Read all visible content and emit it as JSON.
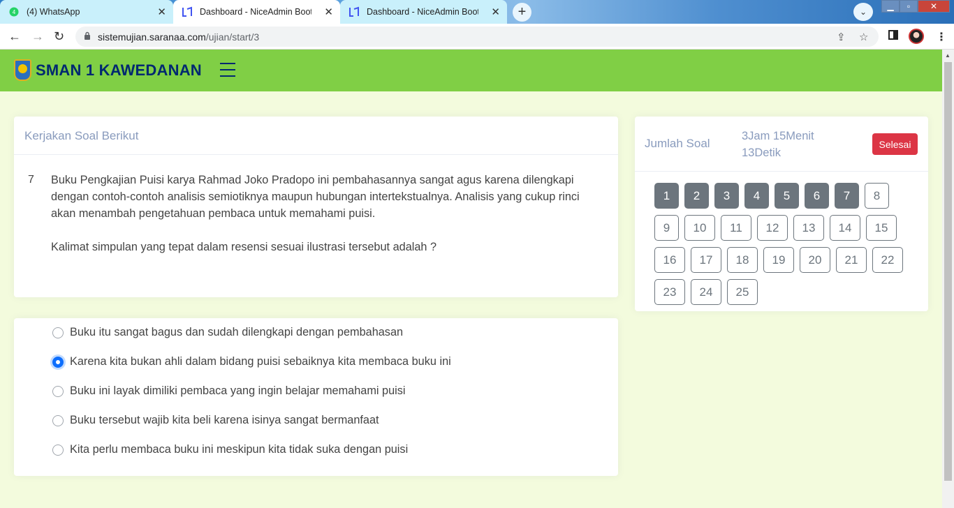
{
  "browser": {
    "tabs": [
      {
        "title": "(4) WhatsApp",
        "icon": "whatsapp-icon"
      },
      {
        "title": "Dashboard - NiceAdmin Bootstrap",
        "icon": "niceadmin-icon"
      },
      {
        "title": "Dashboard - NiceAdmin Bootstrap",
        "icon": "niceadmin-icon"
      }
    ],
    "url_host": "sistemujian.saranaa.com",
    "url_path": "/ujian/start/3"
  },
  "header": {
    "school_name": "SMAN 1 KAWEDANAN"
  },
  "question_card": {
    "heading": "Kerjakan Soal Berikut",
    "number": "7",
    "paragraph1": "Buku Pengkajian Puisi karya Rahmad Joko Pradopo ini pembahasannya sangat agus karena dilengkapi dengan contoh-contoh analisis semiotiknya maupun hubungan intertekstualnya. Analisis yang cukup rinci akan menambah pengetahuan pembaca untuk memahami puisi.",
    "paragraph2": "Kalimat simpulan yang tepat dalam resensi sesuai ilustrasi tersebut adalah ?"
  },
  "answers": {
    "options": [
      {
        "text": "Buku itu sangat bagus dan sudah dilengkapi dengan pembahasan",
        "selected": false
      },
      {
        "text": "Karena kita bukan ahli dalam bidang puisi sebaiknya kita membaca buku ini",
        "selected": true
      },
      {
        "text": "Buku ini layak dimiliki pembaca yang ingin belajar memahami puisi",
        "selected": false
      },
      {
        "text": "Buku tersebut wajib kita beli karena isinya sangat bermanfaat",
        "selected": false
      },
      {
        "text": "Kita perlu membaca buku ini meskipun kita tidak suka dengan puisi",
        "selected": false
      }
    ]
  },
  "side_panel": {
    "label": "Jumlah Soal",
    "timer_line1": "3Jam 15Menit",
    "timer_line2": "13Detik",
    "finish_label": "Selesai",
    "questions": [
      {
        "n": "1",
        "answered": true
      },
      {
        "n": "2",
        "answered": true
      },
      {
        "n": "3",
        "answered": true
      },
      {
        "n": "4",
        "answered": true
      },
      {
        "n": "5",
        "answered": true
      },
      {
        "n": "6",
        "answered": true
      },
      {
        "n": "7",
        "answered": true
      },
      {
        "n": "8",
        "answered": false
      },
      {
        "n": "9",
        "answered": false
      },
      {
        "n": "10",
        "answered": false
      },
      {
        "n": "11",
        "answered": false
      },
      {
        "n": "12",
        "answered": false
      },
      {
        "n": "13",
        "answered": false
      },
      {
        "n": "14",
        "answered": false
      },
      {
        "n": "15",
        "answered": false
      },
      {
        "n": "16",
        "answered": false
      },
      {
        "n": "17",
        "answered": false
      },
      {
        "n": "18",
        "answered": false
      },
      {
        "n": "19",
        "answered": false
      },
      {
        "n": "20",
        "answered": false
      },
      {
        "n": "21",
        "answered": false
      },
      {
        "n": "22",
        "answered": false
      },
      {
        "n": "23",
        "answered": false
      },
      {
        "n": "24",
        "answered": false
      },
      {
        "n": "25",
        "answered": false
      }
    ]
  },
  "colors": {
    "header_bg": "#80cf45",
    "brand_text": "#012970",
    "page_bg": "#f3fbdd",
    "danger": "#dc3545",
    "answered": "#6c757d",
    "radio_selected": "#0d6efd"
  }
}
